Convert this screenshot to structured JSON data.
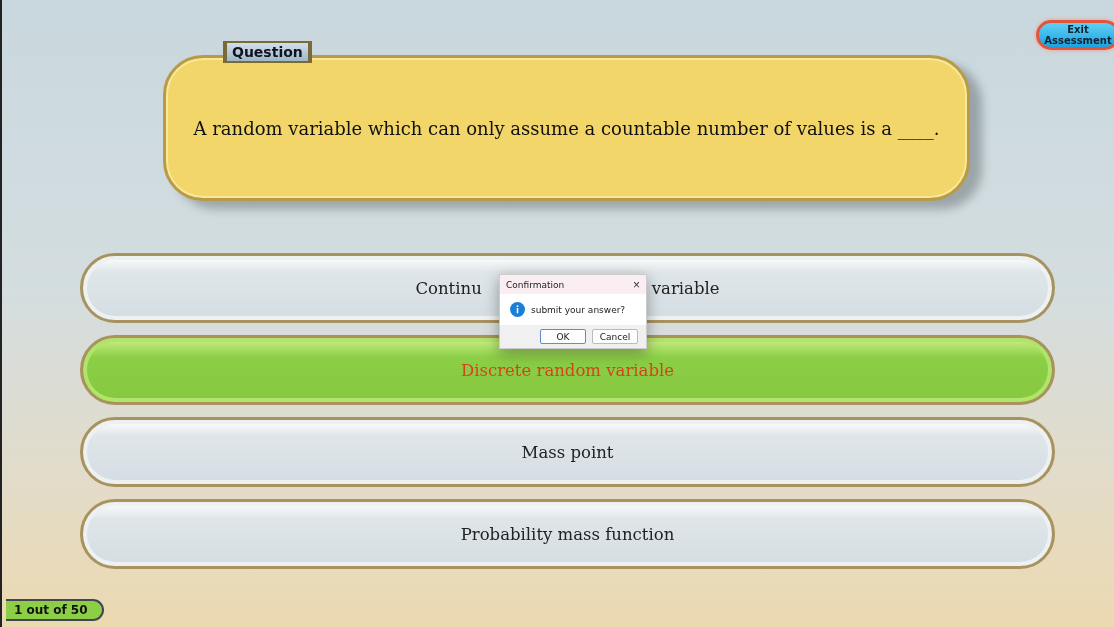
{
  "exit_button": "Exit Assessment",
  "question": {
    "tag": "Question",
    "text": "A random variable which can only assume a countable number of values is a ____."
  },
  "options": [
    {
      "label_parts": [
        "Continu",
        "variable"
      ],
      "selected": false
    },
    {
      "label_parts": [
        "Discrete random variable"
      ],
      "selected": true
    },
    {
      "label_parts": [
        "Mass point"
      ],
      "selected": false
    },
    {
      "label_parts": [
        "Probability mass function"
      ],
      "selected": false
    }
  ],
  "progress": "1 out of 50",
  "dialog": {
    "title": "Confirmation",
    "close": "×",
    "message": "submit your answer?",
    "buttons": [
      "OK",
      "Cancel"
    ]
  }
}
